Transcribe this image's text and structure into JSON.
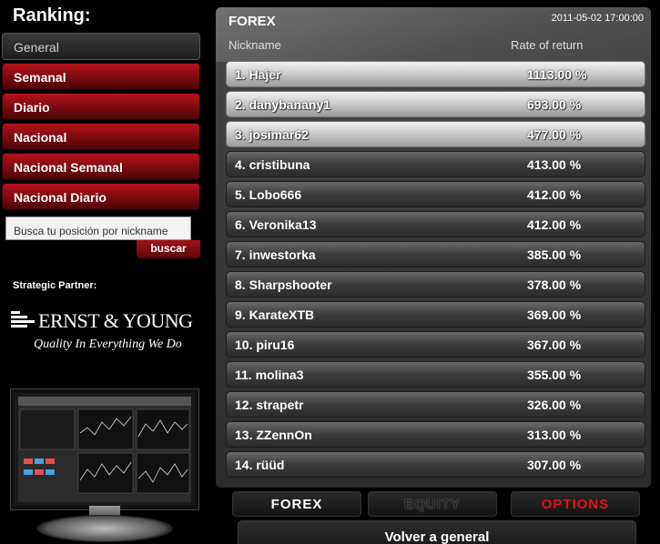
{
  "sidebar": {
    "title": "Ranking:",
    "items": [
      {
        "label": "General"
      },
      {
        "label": "Semanal"
      },
      {
        "label": "Diario"
      },
      {
        "label": "Nacional"
      },
      {
        "label": "Nacional Semanal"
      },
      {
        "label": "Nacional Diario"
      }
    ],
    "search": {
      "placeholder": "Busca tu posición por nickname",
      "button_label": "buscar"
    },
    "partner_label": "Strategic Partner:",
    "partner_logo": {
      "name": "ERNST & YOUNG",
      "tagline": "Quality In Everything We Do"
    }
  },
  "panel": {
    "title": "FOREX",
    "datetime": "2011-05-02 17:00:00",
    "column_nickname": "Nickname",
    "column_rate": "Rate of return",
    "rows": [
      {
        "nickname": "1. Hajer",
        "rate": "1113.00 %"
      },
      {
        "nickname": "2. danybanany1",
        "rate": "693.00 %"
      },
      {
        "nickname": "3. josimar62",
        "rate": "477.00 %"
      },
      {
        "nickname": "4. cristibuna",
        "rate": "413.00 %"
      },
      {
        "nickname": "5. Lobo666",
        "rate": "412.00 %"
      },
      {
        "nickname": "6. Veronika13",
        "rate": "412.00 %"
      },
      {
        "nickname": "7. inwestorka",
        "rate": "385.00 %"
      },
      {
        "nickname": "8. Sharpshooter",
        "rate": "378.00 %"
      },
      {
        "nickname": "9. KarateXTB",
        "rate": "369.00 %"
      },
      {
        "nickname": "10. piru16",
        "rate": "367.00 %"
      },
      {
        "nickname": "11. molina3",
        "rate": "355.00 %"
      },
      {
        "nickname": "12. strapetr",
        "rate": "326.00 %"
      },
      {
        "nickname": "13. ZZennOn",
        "rate": "313.00 %"
      },
      {
        "nickname": "14. rüüd",
        "rate": "307.00 %"
      }
    ]
  },
  "tabs": [
    {
      "label": "FOREX"
    },
    {
      "label": "EQUITY"
    },
    {
      "label": "OPTIONS"
    }
  ],
  "back_button_label": "Volver a general",
  "colors": {
    "accent_red": "#b5121b",
    "options_red": "#e0121b",
    "panel_bg": "#3a3a3a"
  }
}
